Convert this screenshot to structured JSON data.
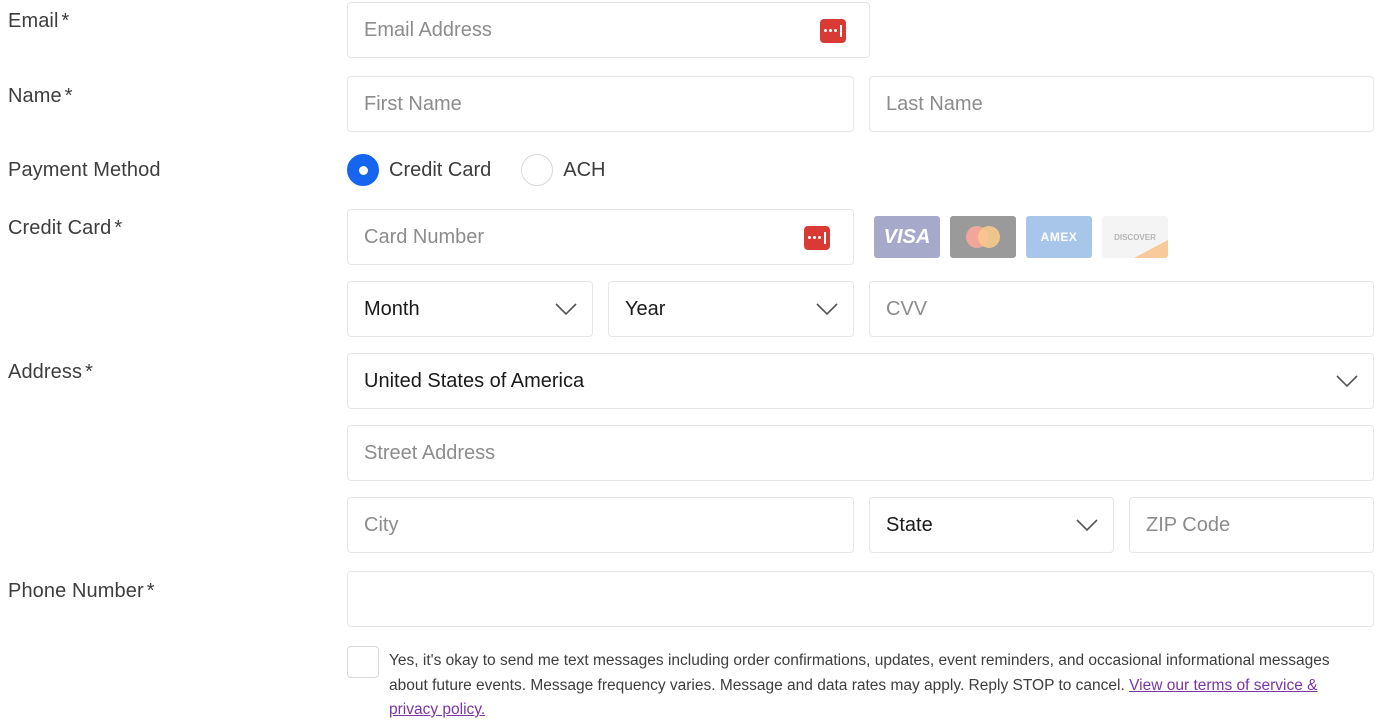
{
  "labels": {
    "email": "Email",
    "name": "Name",
    "payment_method": "Payment Method",
    "credit_card": "Credit Card",
    "address": "Address",
    "phone": "Phone Number",
    "required_mark": "*"
  },
  "email": {
    "placeholder": "Email Address"
  },
  "name": {
    "first_placeholder": "First Name",
    "last_placeholder": "Last Name"
  },
  "payment": {
    "options": [
      {
        "label": "Credit Card",
        "selected": true
      },
      {
        "label": "ACH",
        "selected": false
      }
    ]
  },
  "card": {
    "number_placeholder": "Card Number",
    "logos": [
      {
        "name": "visa-logo",
        "text": "VISA",
        "color": "#1a1f71"
      },
      {
        "name": "mastercard-logo",
        "text": "",
        "color": "#eb001b"
      },
      {
        "name": "amex-logo",
        "text": "AMEX",
        "color": "#2e77bc"
      },
      {
        "name": "discover-logo",
        "text": "DISCOVER",
        "color": "#f58220"
      }
    ],
    "month_value": "Month",
    "year_value": "Year",
    "cvv_placeholder": "CVV"
  },
  "address": {
    "country_value": "United States of America",
    "street_placeholder": "Street Address",
    "city_placeholder": "City",
    "state_value": "State",
    "zip_placeholder": "ZIP Code"
  },
  "phone": {
    "placeholder": ""
  },
  "consent": {
    "text": "Yes, it's okay to send me text messages including order confirmations, updates, event reminders, and occasional informational messages about future events. Message frequency varies. Message and data rates may apply. Reply STOP to cancel. ",
    "link_text": "View our terms of service & privacy policy.",
    "checked": false
  },
  "colors": {
    "accent": "#1565f0",
    "password_manager": "#d93a33",
    "link": "#7a35a5"
  },
  "icons": {
    "password_manager": "password-manager-icon",
    "dropdown": "chevron-down-icon"
  }
}
